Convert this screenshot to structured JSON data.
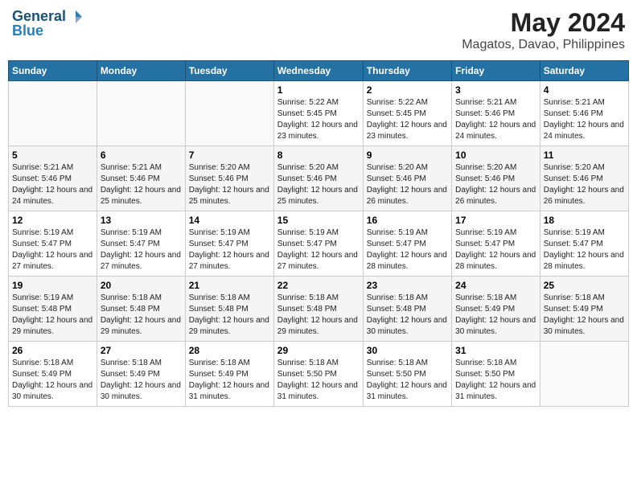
{
  "logo": {
    "line1": "General",
    "line2": "Blue"
  },
  "title": "May 2024",
  "location": "Magatos, Davao, Philippines",
  "weekdays": [
    "Sunday",
    "Monday",
    "Tuesday",
    "Wednesday",
    "Thursday",
    "Friday",
    "Saturday"
  ],
  "weeks": [
    [
      null,
      null,
      null,
      {
        "day": "1",
        "sunrise": "Sunrise: 5:22 AM",
        "sunset": "Sunset: 5:45 PM",
        "daylight": "Daylight: 12 hours and 23 minutes."
      },
      {
        "day": "2",
        "sunrise": "Sunrise: 5:22 AM",
        "sunset": "Sunset: 5:45 PM",
        "daylight": "Daylight: 12 hours and 23 minutes."
      },
      {
        "day": "3",
        "sunrise": "Sunrise: 5:21 AM",
        "sunset": "Sunset: 5:46 PM",
        "daylight": "Daylight: 12 hours and 24 minutes."
      },
      {
        "day": "4",
        "sunrise": "Sunrise: 5:21 AM",
        "sunset": "Sunset: 5:46 PM",
        "daylight": "Daylight: 12 hours and 24 minutes."
      }
    ],
    [
      {
        "day": "5",
        "sunrise": "Sunrise: 5:21 AM",
        "sunset": "Sunset: 5:46 PM",
        "daylight": "Daylight: 12 hours and 24 minutes."
      },
      {
        "day": "6",
        "sunrise": "Sunrise: 5:21 AM",
        "sunset": "Sunset: 5:46 PM",
        "daylight": "Daylight: 12 hours and 25 minutes."
      },
      {
        "day": "7",
        "sunrise": "Sunrise: 5:20 AM",
        "sunset": "Sunset: 5:46 PM",
        "daylight": "Daylight: 12 hours and 25 minutes."
      },
      {
        "day": "8",
        "sunrise": "Sunrise: 5:20 AM",
        "sunset": "Sunset: 5:46 PM",
        "daylight": "Daylight: 12 hours and 25 minutes."
      },
      {
        "day": "9",
        "sunrise": "Sunrise: 5:20 AM",
        "sunset": "Sunset: 5:46 PM",
        "daylight": "Daylight: 12 hours and 26 minutes."
      },
      {
        "day": "10",
        "sunrise": "Sunrise: 5:20 AM",
        "sunset": "Sunset: 5:46 PM",
        "daylight": "Daylight: 12 hours and 26 minutes."
      },
      {
        "day": "11",
        "sunrise": "Sunrise: 5:20 AM",
        "sunset": "Sunset: 5:46 PM",
        "daylight": "Daylight: 12 hours and 26 minutes."
      }
    ],
    [
      {
        "day": "12",
        "sunrise": "Sunrise: 5:19 AM",
        "sunset": "Sunset: 5:47 PM",
        "daylight": "Daylight: 12 hours and 27 minutes."
      },
      {
        "day": "13",
        "sunrise": "Sunrise: 5:19 AM",
        "sunset": "Sunset: 5:47 PM",
        "daylight": "Daylight: 12 hours and 27 minutes."
      },
      {
        "day": "14",
        "sunrise": "Sunrise: 5:19 AM",
        "sunset": "Sunset: 5:47 PM",
        "daylight": "Daylight: 12 hours and 27 minutes."
      },
      {
        "day": "15",
        "sunrise": "Sunrise: 5:19 AM",
        "sunset": "Sunset: 5:47 PM",
        "daylight": "Daylight: 12 hours and 27 minutes."
      },
      {
        "day": "16",
        "sunrise": "Sunrise: 5:19 AM",
        "sunset": "Sunset: 5:47 PM",
        "daylight": "Daylight: 12 hours and 28 minutes."
      },
      {
        "day": "17",
        "sunrise": "Sunrise: 5:19 AM",
        "sunset": "Sunset: 5:47 PM",
        "daylight": "Daylight: 12 hours and 28 minutes."
      },
      {
        "day": "18",
        "sunrise": "Sunrise: 5:19 AM",
        "sunset": "Sunset: 5:47 PM",
        "daylight": "Daylight: 12 hours and 28 minutes."
      }
    ],
    [
      {
        "day": "19",
        "sunrise": "Sunrise: 5:19 AM",
        "sunset": "Sunset: 5:48 PM",
        "daylight": "Daylight: 12 hours and 29 minutes."
      },
      {
        "day": "20",
        "sunrise": "Sunrise: 5:18 AM",
        "sunset": "Sunset: 5:48 PM",
        "daylight": "Daylight: 12 hours and 29 minutes."
      },
      {
        "day": "21",
        "sunrise": "Sunrise: 5:18 AM",
        "sunset": "Sunset: 5:48 PM",
        "daylight": "Daylight: 12 hours and 29 minutes."
      },
      {
        "day": "22",
        "sunrise": "Sunrise: 5:18 AM",
        "sunset": "Sunset: 5:48 PM",
        "daylight": "Daylight: 12 hours and 29 minutes."
      },
      {
        "day": "23",
        "sunrise": "Sunrise: 5:18 AM",
        "sunset": "Sunset: 5:48 PM",
        "daylight": "Daylight: 12 hours and 30 minutes."
      },
      {
        "day": "24",
        "sunrise": "Sunrise: 5:18 AM",
        "sunset": "Sunset: 5:49 PM",
        "daylight": "Daylight: 12 hours and 30 minutes."
      },
      {
        "day": "25",
        "sunrise": "Sunrise: 5:18 AM",
        "sunset": "Sunset: 5:49 PM",
        "daylight": "Daylight: 12 hours and 30 minutes."
      }
    ],
    [
      {
        "day": "26",
        "sunrise": "Sunrise: 5:18 AM",
        "sunset": "Sunset: 5:49 PM",
        "daylight": "Daylight: 12 hours and 30 minutes."
      },
      {
        "day": "27",
        "sunrise": "Sunrise: 5:18 AM",
        "sunset": "Sunset: 5:49 PM",
        "daylight": "Daylight: 12 hours and 30 minutes."
      },
      {
        "day": "28",
        "sunrise": "Sunrise: 5:18 AM",
        "sunset": "Sunset: 5:49 PM",
        "daylight": "Daylight: 12 hours and 31 minutes."
      },
      {
        "day": "29",
        "sunrise": "Sunrise: 5:18 AM",
        "sunset": "Sunset: 5:50 PM",
        "daylight": "Daylight: 12 hours and 31 minutes."
      },
      {
        "day": "30",
        "sunrise": "Sunrise: 5:18 AM",
        "sunset": "Sunset: 5:50 PM",
        "daylight": "Daylight: 12 hours and 31 minutes."
      },
      {
        "day": "31",
        "sunrise": "Sunrise: 5:18 AM",
        "sunset": "Sunset: 5:50 PM",
        "daylight": "Daylight: 12 hours and 31 minutes."
      },
      null
    ]
  ]
}
